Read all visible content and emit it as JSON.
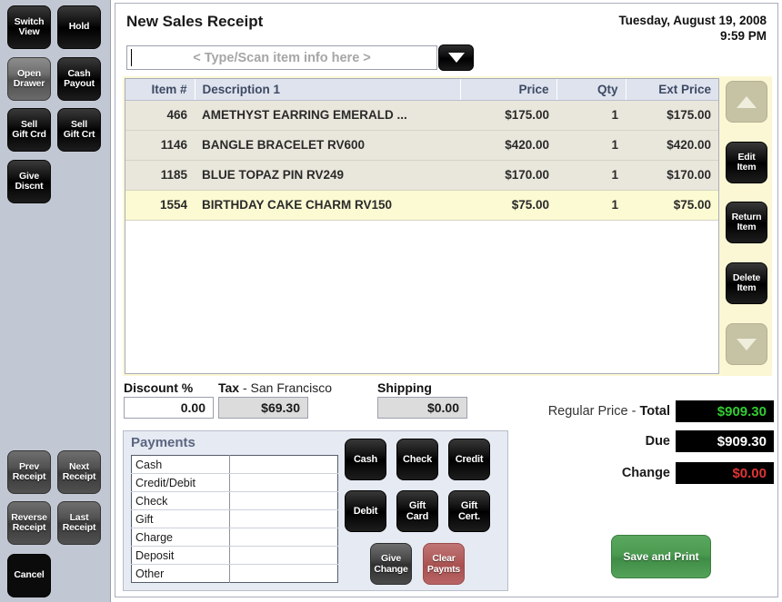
{
  "sidebar": {
    "top_buttons": [
      {
        "label_line1": "Switch",
        "label_line2": "View",
        "name": "switch-view",
        "style": "black"
      },
      {
        "label_line1": "Hold",
        "label_line2": "",
        "name": "hold",
        "style": "black"
      },
      {
        "label_line1": "Open",
        "label_line2": "Drawer",
        "name": "open-drawer",
        "style": "gray"
      },
      {
        "label_line1": "Cash",
        "label_line2": "Payout",
        "name": "cash-payout",
        "style": "black"
      },
      {
        "label_line1": "Sell",
        "label_line2": "Gift Crd",
        "name": "sell-gift-card",
        "style": "black"
      },
      {
        "label_line1": "Sell",
        "label_line2": "Gift Crt",
        "name": "sell-gift-cert",
        "style": "black"
      },
      {
        "label_line1": "Give",
        "label_line2": "Discnt",
        "name": "give-discount",
        "style": "black"
      }
    ],
    "bottom_buttons": [
      {
        "label_line1": "Prev",
        "label_line2": "Receipt",
        "name": "prev-receipt",
        "style": "darkgray"
      },
      {
        "label_line1": "Next",
        "label_line2": "Receipt",
        "name": "next-receipt",
        "style": "darkgray"
      },
      {
        "label_line1": "Reverse",
        "label_line2": "Receipt",
        "name": "reverse-receipt",
        "style": "darkgray"
      },
      {
        "label_line1": "Last",
        "label_line2": "Receipt",
        "name": "last-receipt",
        "style": "darkgray"
      },
      {
        "label_line1": "Cancel",
        "label_line2": "",
        "name": "cancel",
        "style": "flat-black"
      }
    ]
  },
  "header": {
    "title": "New Sales Receipt",
    "date": "Tuesday, August 19, 2008",
    "time": "9:59 PM"
  },
  "scan": {
    "placeholder": "< Type/Scan item info here >",
    "value": "",
    "dropdown_icon": "chevron-down-icon"
  },
  "grid": {
    "columns": [
      "Item #",
      "Description 1",
      "Price",
      "Qty",
      "Ext Price"
    ],
    "rows": [
      {
        "item": "466",
        "desc": "AMETHYST EARRING EMERALD ...",
        "price": "$175.00",
        "qty": "1",
        "ext": "$175.00",
        "selected": false
      },
      {
        "item": "1146",
        "desc": "BANGLE BRACELET RV600",
        "price": "$420.00",
        "qty": "1",
        "ext": "$420.00",
        "selected": false
      },
      {
        "item": "1185",
        "desc": "BLUE TOPAZ PIN RV249",
        "price": "$170.00",
        "qty": "1",
        "ext": "$170.00",
        "selected": false
      },
      {
        "item": "1554",
        "desc": "BIRTHDAY CAKE CHARM RV150",
        "price": "$75.00",
        "qty": "1",
        "ext": "$75.00",
        "selected": true
      }
    ],
    "side_buttons": [
      {
        "label_line1": "",
        "label_line2": "",
        "name": "scroll-up",
        "icon": "triangle-up-icon"
      },
      {
        "label_line1": "Edit",
        "label_line2": "Item",
        "name": "edit-item"
      },
      {
        "label_line1": "Return",
        "label_line2": "Item",
        "name": "return-item"
      },
      {
        "label_line1": "Delete",
        "label_line2": "Item",
        "name": "delete-item"
      },
      {
        "label_line1": "",
        "label_line2": "",
        "name": "scroll-down",
        "icon": "triangle-down-icon"
      }
    ]
  },
  "fields": {
    "discount_label": "Discount %",
    "discount_value": "0.00",
    "tax_label_bold": "Tax",
    "tax_label_rest": " - San Francisco",
    "tax_value": "$69.30",
    "shipping_label": "Shipping",
    "shipping_value": "$0.00"
  },
  "totals": {
    "total_prefix": "Regular Price - ",
    "total_label": "Total",
    "total_value": "$909.30",
    "due_label": "Due",
    "due_value": "$909.30",
    "change_label": "Change",
    "change_value": "$0.00",
    "total_color": "#33cc33",
    "due_color": "#ffffff",
    "change_color": "#e03535"
  },
  "payments": {
    "title": "Payments",
    "rows": [
      {
        "name": "Cash",
        "amount": ""
      },
      {
        "name": "Credit/Debit",
        "amount": ""
      },
      {
        "name": "Check",
        "amount": ""
      },
      {
        "name": "Gift",
        "amount": ""
      },
      {
        "name": "Charge",
        "amount": ""
      },
      {
        "name": "Deposit",
        "amount": ""
      },
      {
        "name": "Other",
        "amount": ""
      }
    ],
    "buttons": [
      {
        "label_line1": "Cash",
        "label_line2": "",
        "name": "pay-cash",
        "style": "black"
      },
      {
        "label_line1": "Check",
        "label_line2": "",
        "name": "pay-check",
        "style": "black"
      },
      {
        "label_line1": "Credit",
        "label_line2": "",
        "name": "pay-credit",
        "style": "black"
      },
      {
        "label_line1": "Debit",
        "label_line2": "",
        "name": "pay-debit",
        "style": "black"
      },
      {
        "label_line1": "Gift",
        "label_line2": "Card",
        "name": "pay-gift-card",
        "style": "black"
      },
      {
        "label_line1": "Gift",
        "label_line2": "Cert.",
        "name": "pay-gift-cert",
        "style": "black"
      },
      {
        "label_line1": "Give",
        "label_line2": "Change",
        "name": "give-change",
        "style": "gray"
      },
      {
        "label_line1": "Clear",
        "label_line2": "Paymts",
        "name": "clear-payments",
        "style": "red"
      }
    ]
  },
  "actions": {
    "save_print_label": "Save and Print"
  }
}
